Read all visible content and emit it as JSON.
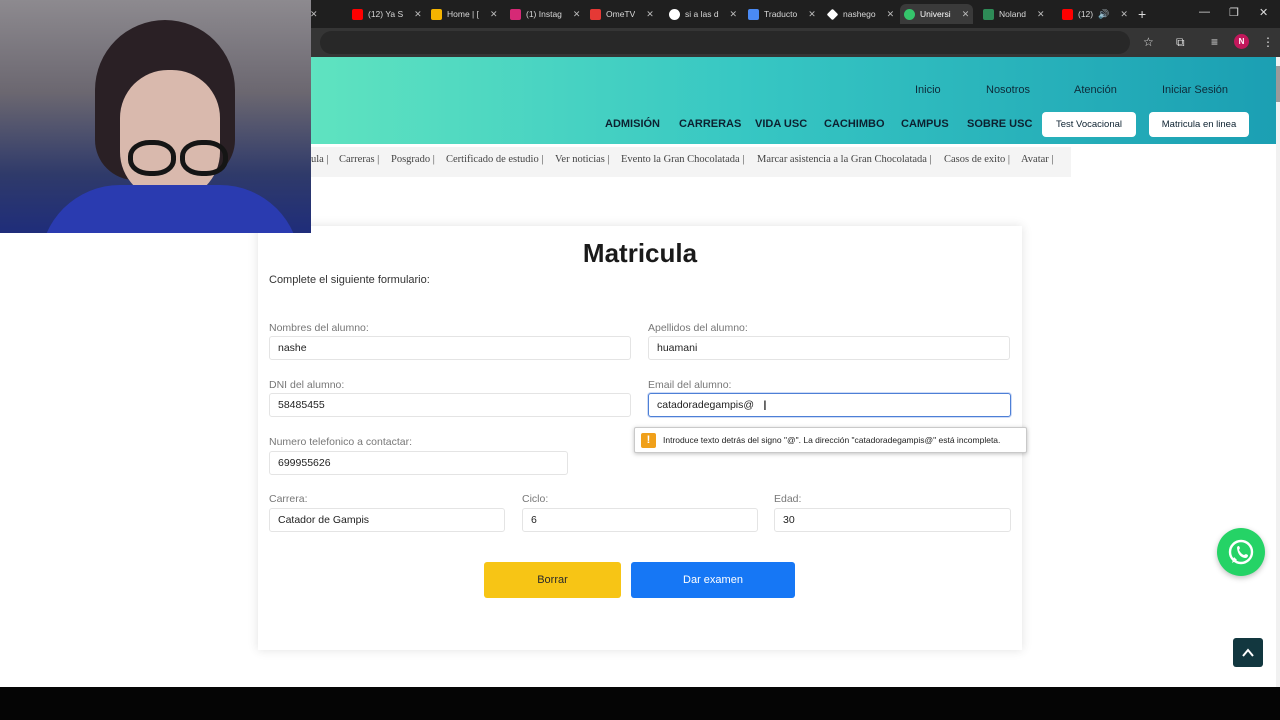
{
  "browser": {
    "tabs": [
      {
        "label": "",
        "icon": "tab-favicon-partial",
        "color": "#888888"
      },
      {
        "label": "(12) Ya S",
        "icon": "youtube-icon",
        "color": "#ff0000"
      },
      {
        "label": "Home | [",
        "icon": "home-icon",
        "color": "#f5b400"
      },
      {
        "label": "(1) Instag",
        "icon": "instagram-icon",
        "color": "#d62976"
      },
      {
        "label": "OmeTV",
        "icon": "ometv-icon",
        "color": "#e53935"
      },
      {
        "label": "si a las d",
        "icon": "google-icon",
        "color": "#ffffff"
      },
      {
        "label": "Traducto",
        "icon": "translate-icon",
        "color": "#4a8af4"
      },
      {
        "label": "nashego",
        "icon": "diamond-icon",
        "color": "#ffffff"
      },
      {
        "label": "Universi",
        "icon": "university-icon",
        "color": "#35c46b"
      },
      {
        "label": "Noland",
        "icon": "noland-icon",
        "color": "#2e8b57"
      },
      {
        "label": "(12)",
        "icon": "youtube-icon",
        "color": "#ff0000"
      }
    ],
    "new_tab": "+",
    "window_controls": [
      "—",
      "❐",
      "✕"
    ],
    "profile_initial": "N"
  },
  "header": {
    "top_links": [
      "Inicio",
      "Nosotros",
      "Atención",
      "Iniciar Sesión"
    ],
    "nav_items": [
      "ADMISIÓN",
      "CARRERAS",
      "VIDA USC",
      "CACHIMBO",
      "CAMPUS",
      "SOBRE USC"
    ],
    "btn_test": "Test Vocacional",
    "btn_matricula": "Matricula en linea"
  },
  "breadcrumbs": [
    "ula |",
    "Carreras |",
    "Posgrado |",
    "Certificado de estudio |",
    "Ver noticias |",
    "Evento la Gran Chocolatada |",
    "Marcar asistencia a la Gran Chocolatada |",
    "Casos de exito |",
    "Avatar |"
  ],
  "form": {
    "title": "Matricula",
    "subtitle": "Complete el siguiente formulario:",
    "nombres_label": "Nombres del alumno:",
    "nombres_value": "nashe",
    "apellidos_label": "Apellidos del alumno:",
    "apellidos_value": "huamani",
    "dni_label": "DNI del alumno:",
    "dni_value": "58485455",
    "email_label": "Email del alumno:",
    "email_value": "catadoradegampis@",
    "telefono_label": "Numero telefonico a contactar:",
    "telefono_value": "699955626",
    "carrera_label": "Carrera:",
    "carrera_value": "Catador de Gampis",
    "ciclo_label": "Ciclo:",
    "ciclo_value": "6",
    "edad_label": "Edad:",
    "edad_value": "30",
    "validation_message": "Introduce texto detrás del signo \"@\". La dirección \"catadoradegampis@\" está incompleta.",
    "btn_borrar": "Borrar",
    "btn_examen": "Dar examen"
  },
  "colors": {
    "header_gradient_start": "#5fe3c0",
    "header_gradient_end": "#1b9fb3",
    "btn_borrar": "#f7c515",
    "btn_examen": "#1677f5",
    "whatsapp": "#25d366",
    "totop": "#12373f"
  }
}
